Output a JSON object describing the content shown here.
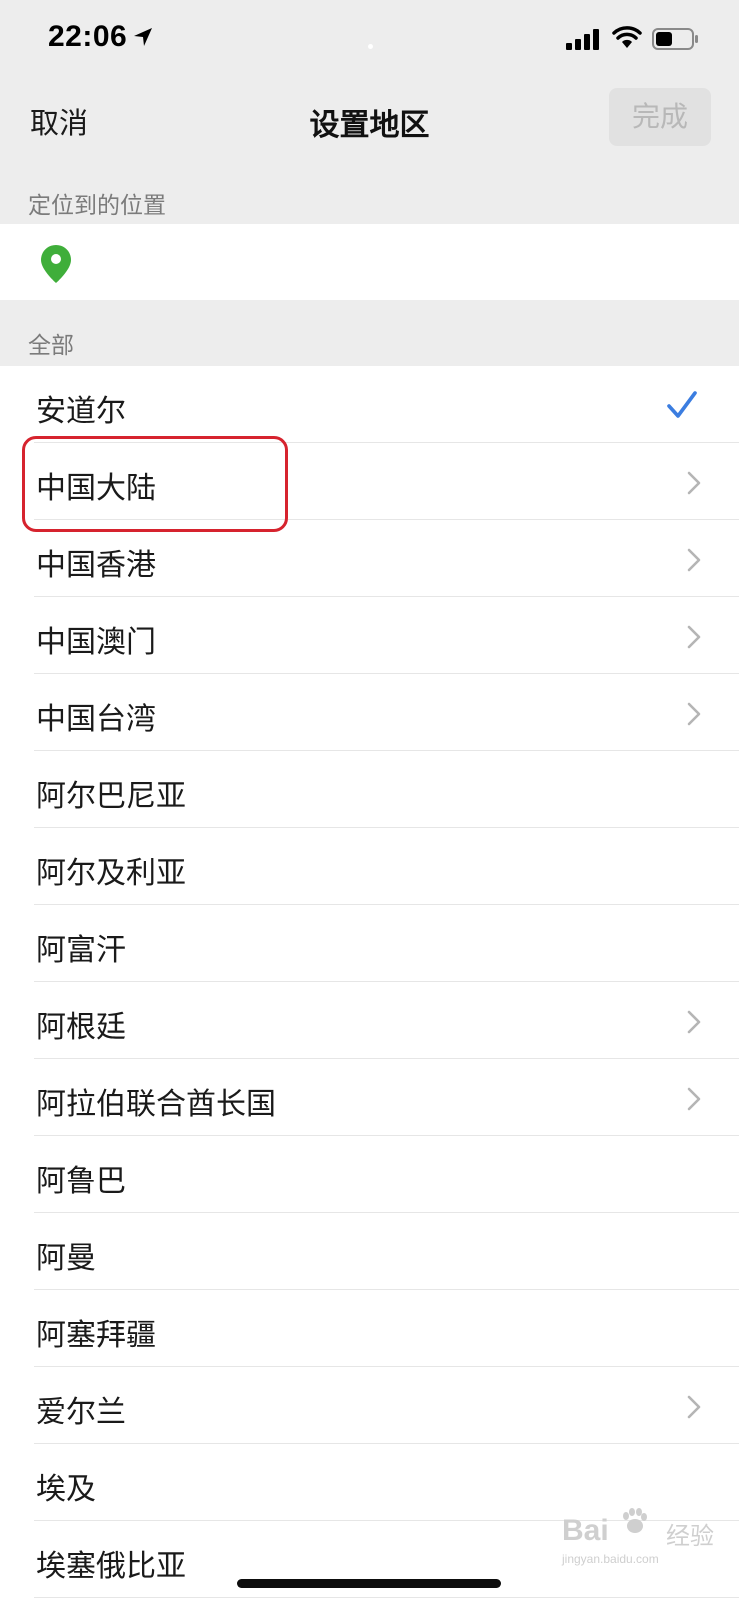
{
  "status_bar": {
    "time": "22:06",
    "icons": [
      "location-arrow-icon",
      "signal-bars-icon",
      "wifi-icon",
      "battery-icon"
    ]
  },
  "nav": {
    "cancel_label": "取消",
    "title": "设置地区",
    "done_label": "完成"
  },
  "sections": {
    "location_header": "定位到的位置",
    "location_icon": "location-pin-icon",
    "all_header": "全部"
  },
  "regions": [
    {
      "label": "安道尔",
      "accessory": "check"
    },
    {
      "label": "中国大陆",
      "accessory": "chevron",
      "highlighted": true
    },
    {
      "label": "中国香港",
      "accessory": "chevron"
    },
    {
      "label": "中国澳门",
      "accessory": "chevron"
    },
    {
      "label": "中国台湾",
      "accessory": "chevron"
    },
    {
      "label": "阿尔巴尼亚",
      "accessory": "none"
    },
    {
      "label": "阿尔及利亚",
      "accessory": "none"
    },
    {
      "label": "阿富汗",
      "accessory": "none"
    },
    {
      "label": "阿根廷",
      "accessory": "chevron"
    },
    {
      "label": "阿拉伯联合酋长国",
      "accessory": "chevron"
    },
    {
      "label": "阿鲁巴",
      "accessory": "none"
    },
    {
      "label": "阿曼",
      "accessory": "none"
    },
    {
      "label": "阿塞拜疆",
      "accessory": "none"
    },
    {
      "label": "爱尔兰",
      "accessory": "chevron"
    },
    {
      "label": "埃及",
      "accessory": "none"
    },
    {
      "label": "埃塞俄比亚",
      "accessory": "none"
    }
  ],
  "watermark": {
    "brand": "Bai",
    "jingyan": "经验",
    "url": "jingyan.baidu.com"
  },
  "colors": {
    "background": "#ededed",
    "list_background": "#ffffff",
    "check": "#3b7de0",
    "pin": "#3fae3a",
    "highlight_box": "#d6232e",
    "done_disabled_bg": "#e1e1e1",
    "done_disabled_text": "#b8b8b8"
  }
}
